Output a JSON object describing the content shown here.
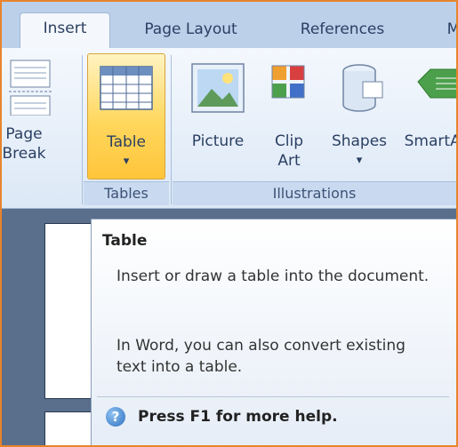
{
  "tabs": [
    {
      "label": "Insert",
      "active": true
    },
    {
      "label": "Page Layout",
      "active": false
    },
    {
      "label": "References",
      "active": false
    },
    {
      "label": "M",
      "active": false
    }
  ],
  "ribbon": {
    "page_break": {
      "line1": "Page",
      "line2": "Break"
    },
    "table": {
      "label": "Table",
      "dropdown": "▾"
    },
    "picture": {
      "label": "Picture"
    },
    "clip_art": {
      "line1": "Clip",
      "line2": "Art"
    },
    "shapes": {
      "label": "Shapes",
      "dropdown": "▾"
    },
    "smartart": {
      "label": "SmartArt"
    },
    "groups": {
      "tables": "Tables",
      "illustrations": "Illustrations"
    }
  },
  "tooltip": {
    "title": "Table",
    "description1": "Insert or draw a table into the document.",
    "description2": "In Word, you can also convert existing text into a table.",
    "help_icon": "?",
    "help_text": "Press F1 for more help."
  },
  "colors": {
    "frame_border": "#e8842c",
    "highlight": "#ffd75d",
    "ribbon": "#dce8f6"
  }
}
